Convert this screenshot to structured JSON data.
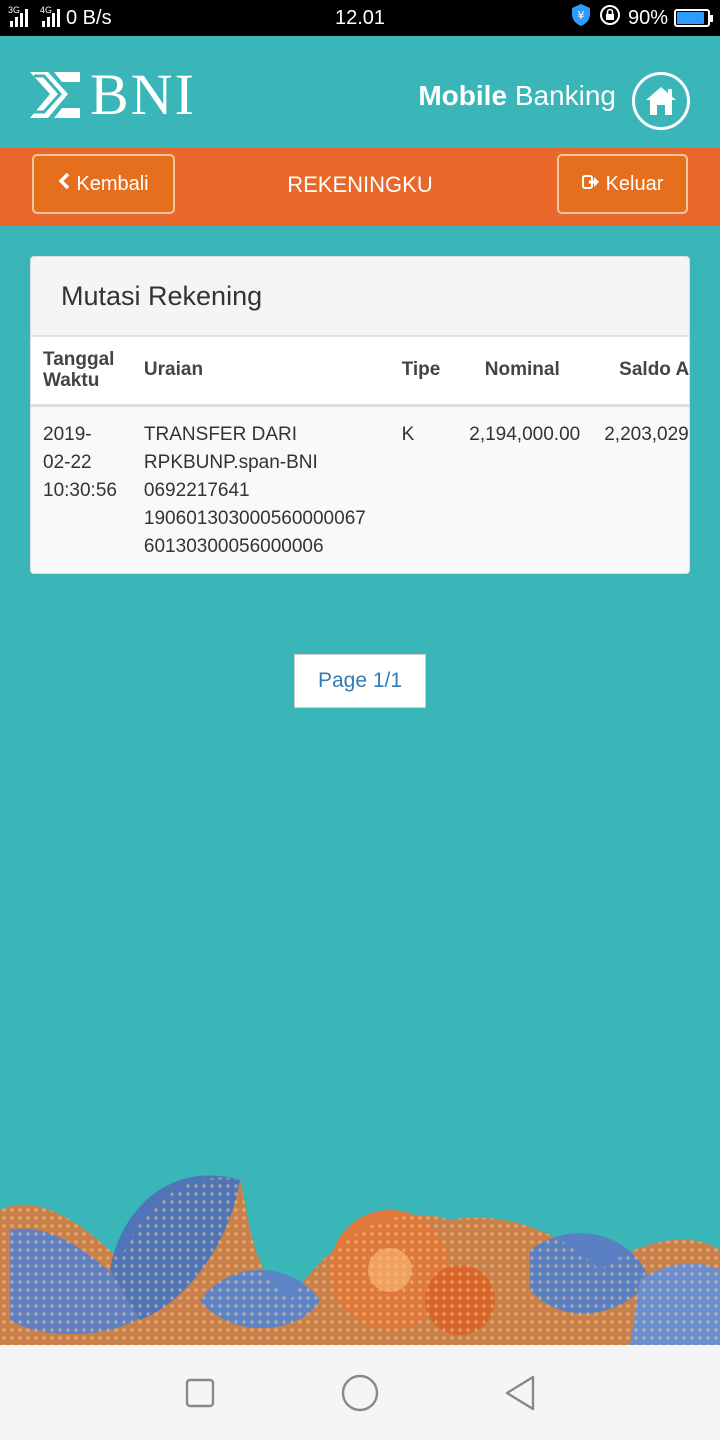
{
  "status_bar": {
    "network_left": "3G",
    "network_right": "4G",
    "speed": "0 B/s",
    "time": "12.01",
    "battery": "90%",
    "battery_level": 0.9
  },
  "header": {
    "logo_text": "BNI",
    "app_title_bold": "Mobile",
    "app_title_rest": "Banking"
  },
  "nav": {
    "back_label": "Kembali",
    "title": "REKENINGKU",
    "exit_label": "Keluar"
  },
  "card": {
    "title": "Mutasi Rekening",
    "columns": {
      "date_line1": "Tanggal",
      "date_line2": "Waktu",
      "desc": "Uraian",
      "type": "Tipe",
      "nominal": "Nominal",
      "saldo": "Saldo Akhir"
    },
    "rows": [
      {
        "date": "2019-",
        "date2": "02-22",
        "time": "10:30:56",
        "desc": [
          "TRANSFER DARI",
          "RPKBUNP.span-BNI",
          "0692217641",
          "19060130300056000006760130300056000006"
        ],
        "desc_line4": "190601303000560000067",
        "desc_line5": "60130300056000006",
        "type": "K",
        "nominal": "2,194,000.00",
        "saldo": "2,203,029"
      }
    ]
  },
  "pager": {
    "label": "Page 1/1"
  },
  "colors": {
    "teal": "#3ab5b8",
    "orange": "#e8672a",
    "link": "#337ab7"
  }
}
